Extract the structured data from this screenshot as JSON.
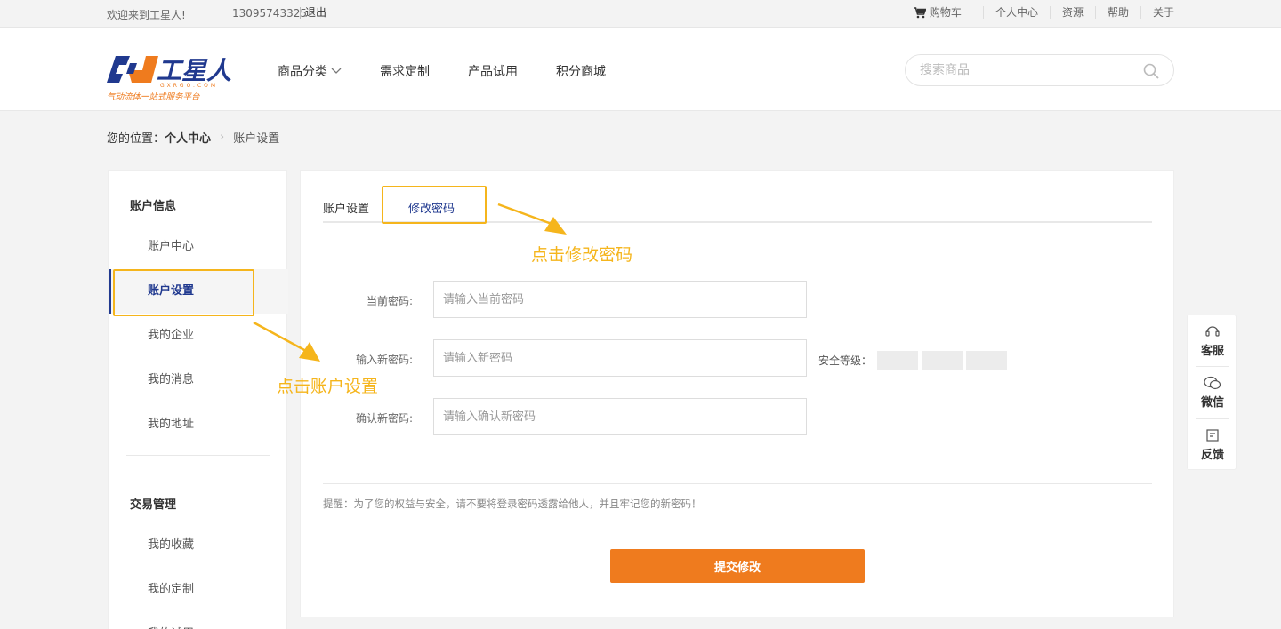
{
  "topbar": {
    "welcome": "欢迎来到工星人!",
    "phone": "13095743325",
    "logout": "退出",
    "nav": [
      "购物车",
      "个人中心",
      "资源",
      "帮助",
      "关于"
    ]
  },
  "logo": {
    "brand": "工星人",
    "domain": "GXRGO.COM",
    "slogan": "气动流体一站式服务平台"
  },
  "mainnav": {
    "items": [
      "商品分类",
      "需求定制",
      "产品试用",
      "积分商城"
    ]
  },
  "search": {
    "placeholder": "搜索商品"
  },
  "breadcrumb": {
    "prefix": "您的位置：",
    "parent": "个人中心",
    "current": "账户设置"
  },
  "sidebar": {
    "section1": "账户信息",
    "items1": [
      "账户中心",
      "账户设置",
      "我的企业",
      "我的消息",
      "我的地址"
    ],
    "section2": "交易管理",
    "items2": [
      "我的收藏",
      "我的定制",
      "我的试用"
    ]
  },
  "main": {
    "tabs": [
      "账户设置",
      "修改密码"
    ],
    "fields": [
      {
        "label": "当前密码:",
        "placeholder": "请输入当前密码"
      },
      {
        "label": "输入新密码:",
        "placeholder": "请输入新密码"
      },
      {
        "label": "确认新密码:",
        "placeholder": "请输入确认新密码"
      }
    ],
    "safety_label": "安全等级：",
    "tip": "提醒：为了您的权益与安全，请不要将登录密码透露给他人，并且牢记您的新密码！",
    "submit": "提交修改"
  },
  "float_service": [
    "客服",
    "微信",
    "反馈"
  ],
  "annotations": {
    "tab_hint": "点击修改密码",
    "side_hint": "点击账户设置"
  },
  "colors": {
    "accent_blue": "#20398f",
    "accent_orange": "#ef7b1e",
    "annotation": "#f5b51c"
  }
}
